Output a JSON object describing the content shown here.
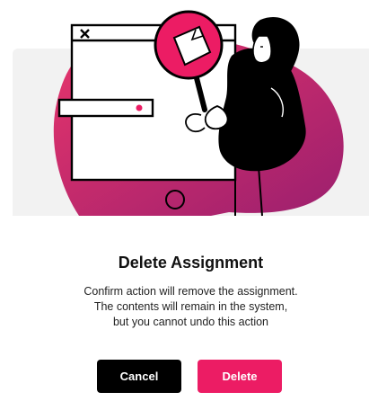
{
  "dialog": {
    "title": "Delete Assignment",
    "message_lines": [
      "Confirm action will remove the assignment.",
      "The contents will remain in the system,",
      "but you cannot undo this action"
    ],
    "cancel_label": "Cancel",
    "delete_label": "Delete"
  },
  "illustration": {
    "icons": [
      "close-icon",
      "magnifier-icon",
      "document-icon"
    ],
    "colors": {
      "accent": "#ec1c64",
      "gradient_start": "#e8356b",
      "gradient_end": "#9b1f6e",
      "ink": "#000000"
    }
  },
  "colors": {
    "cancel_bg": "#000000",
    "delete_bg": "#ec1c64",
    "panel_bg": "#f2f2f2"
  }
}
